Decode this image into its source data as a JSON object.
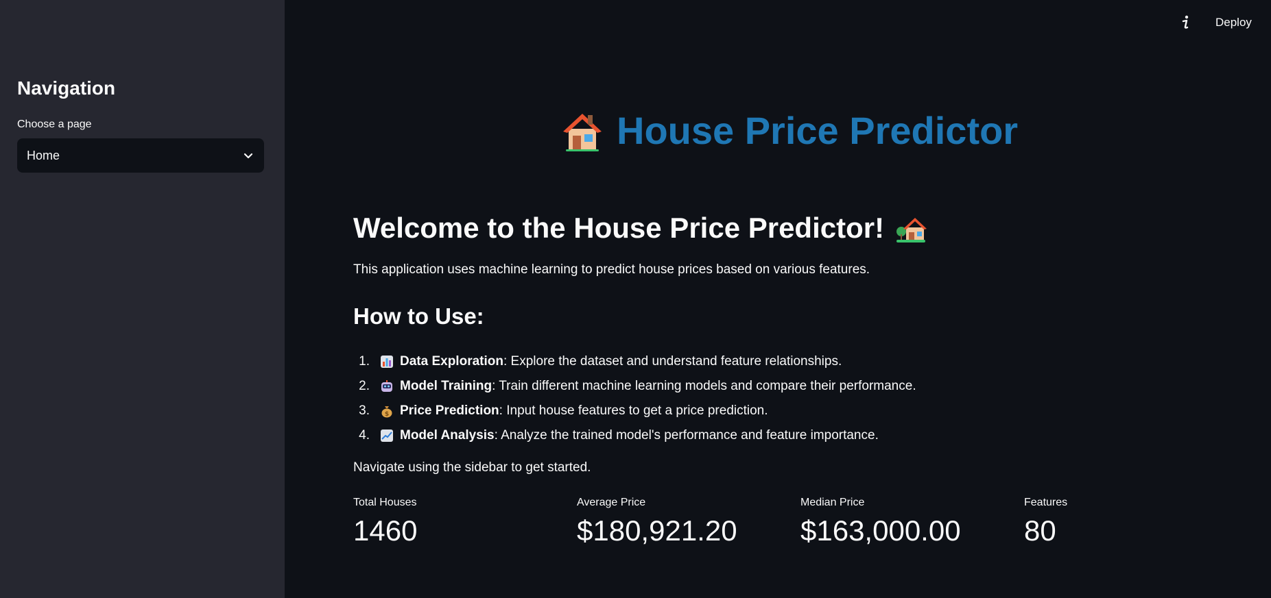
{
  "sidebar": {
    "title": "Navigation",
    "select_label": "Choose a page",
    "select_value": "Home",
    "chevron_icon": "chevron-down-icon"
  },
  "header": {
    "info_icon": "info-icon",
    "deploy_label": "Deploy"
  },
  "main": {
    "title": "House Price Predictor",
    "title_color": "#1f77b4",
    "title_icon": "house-icon",
    "welcome": "Welcome to the House Price Predictor!",
    "intro": "This application uses machine learning to predict house prices based on various features.",
    "howto_heading": "How to Use:",
    "steps": [
      {
        "num": "1.",
        "icon": "bar-chart-icon",
        "title": "Data Exploration",
        "text": ": Explore the dataset and understand feature relationships."
      },
      {
        "num": "2.",
        "icon": "robot-icon",
        "title": "Model Training",
        "text": ": Train different machine learning models and compare their performance."
      },
      {
        "num": "3.",
        "icon": "money-bag-icon",
        "title": "Price Prediction",
        "text": ": Input house features to get a price prediction."
      },
      {
        "num": "4.",
        "icon": "line-chart-icon",
        "title": "Model Analysis",
        "text": ": Analyze the trained model's performance and feature importance."
      }
    ],
    "navigate": "Navigate using the sidebar to get started."
  },
  "metrics": [
    {
      "label": "Total Houses",
      "value": "1460"
    },
    {
      "label": "Average Price",
      "value": "$180,921.20"
    },
    {
      "label": "Median Price",
      "value": "$163,000.00"
    },
    {
      "label": "Features",
      "value": "80"
    }
  ],
  "colors": {
    "background": "#0e1117",
    "sidebar": "#262730",
    "accent": "#1f77b4"
  }
}
